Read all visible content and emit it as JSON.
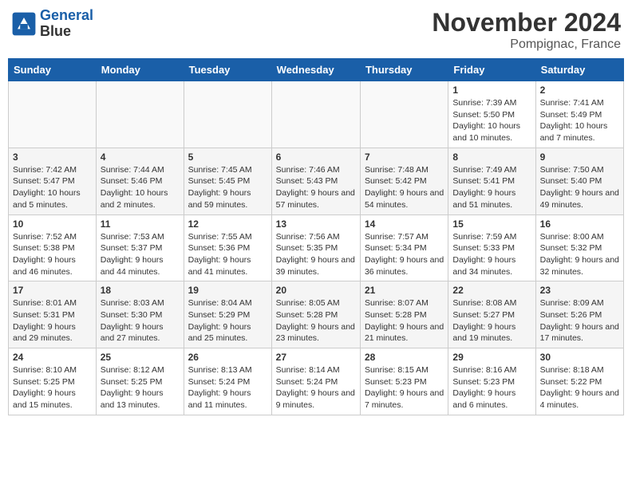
{
  "header": {
    "logo_line1": "General",
    "logo_line2": "Blue",
    "month_title": "November 2024",
    "location": "Pompignac, France"
  },
  "weekdays": [
    "Sunday",
    "Monday",
    "Tuesday",
    "Wednesday",
    "Thursday",
    "Friday",
    "Saturday"
  ],
  "weeks": [
    [
      {
        "day": "",
        "info": ""
      },
      {
        "day": "",
        "info": ""
      },
      {
        "day": "",
        "info": ""
      },
      {
        "day": "",
        "info": ""
      },
      {
        "day": "",
        "info": ""
      },
      {
        "day": "1",
        "info": "Sunrise: 7:39 AM\nSunset: 5:50 PM\nDaylight: 10 hours and 10 minutes."
      },
      {
        "day": "2",
        "info": "Sunrise: 7:41 AM\nSunset: 5:49 PM\nDaylight: 10 hours and 7 minutes."
      }
    ],
    [
      {
        "day": "3",
        "info": "Sunrise: 7:42 AM\nSunset: 5:47 PM\nDaylight: 10 hours and 5 minutes."
      },
      {
        "day": "4",
        "info": "Sunrise: 7:44 AM\nSunset: 5:46 PM\nDaylight: 10 hours and 2 minutes."
      },
      {
        "day": "5",
        "info": "Sunrise: 7:45 AM\nSunset: 5:45 PM\nDaylight: 9 hours and 59 minutes."
      },
      {
        "day": "6",
        "info": "Sunrise: 7:46 AM\nSunset: 5:43 PM\nDaylight: 9 hours and 57 minutes."
      },
      {
        "day": "7",
        "info": "Sunrise: 7:48 AM\nSunset: 5:42 PM\nDaylight: 9 hours and 54 minutes."
      },
      {
        "day": "8",
        "info": "Sunrise: 7:49 AM\nSunset: 5:41 PM\nDaylight: 9 hours and 51 minutes."
      },
      {
        "day": "9",
        "info": "Sunrise: 7:50 AM\nSunset: 5:40 PM\nDaylight: 9 hours and 49 minutes."
      }
    ],
    [
      {
        "day": "10",
        "info": "Sunrise: 7:52 AM\nSunset: 5:38 PM\nDaylight: 9 hours and 46 minutes."
      },
      {
        "day": "11",
        "info": "Sunrise: 7:53 AM\nSunset: 5:37 PM\nDaylight: 9 hours and 44 minutes."
      },
      {
        "day": "12",
        "info": "Sunrise: 7:55 AM\nSunset: 5:36 PM\nDaylight: 9 hours and 41 minutes."
      },
      {
        "day": "13",
        "info": "Sunrise: 7:56 AM\nSunset: 5:35 PM\nDaylight: 9 hours and 39 minutes."
      },
      {
        "day": "14",
        "info": "Sunrise: 7:57 AM\nSunset: 5:34 PM\nDaylight: 9 hours and 36 minutes."
      },
      {
        "day": "15",
        "info": "Sunrise: 7:59 AM\nSunset: 5:33 PM\nDaylight: 9 hours and 34 minutes."
      },
      {
        "day": "16",
        "info": "Sunrise: 8:00 AM\nSunset: 5:32 PM\nDaylight: 9 hours and 32 minutes."
      }
    ],
    [
      {
        "day": "17",
        "info": "Sunrise: 8:01 AM\nSunset: 5:31 PM\nDaylight: 9 hours and 29 minutes."
      },
      {
        "day": "18",
        "info": "Sunrise: 8:03 AM\nSunset: 5:30 PM\nDaylight: 9 hours and 27 minutes."
      },
      {
        "day": "19",
        "info": "Sunrise: 8:04 AM\nSunset: 5:29 PM\nDaylight: 9 hours and 25 minutes."
      },
      {
        "day": "20",
        "info": "Sunrise: 8:05 AM\nSunset: 5:28 PM\nDaylight: 9 hours and 23 minutes."
      },
      {
        "day": "21",
        "info": "Sunrise: 8:07 AM\nSunset: 5:28 PM\nDaylight: 9 hours and 21 minutes."
      },
      {
        "day": "22",
        "info": "Sunrise: 8:08 AM\nSunset: 5:27 PM\nDaylight: 9 hours and 19 minutes."
      },
      {
        "day": "23",
        "info": "Sunrise: 8:09 AM\nSunset: 5:26 PM\nDaylight: 9 hours and 17 minutes."
      }
    ],
    [
      {
        "day": "24",
        "info": "Sunrise: 8:10 AM\nSunset: 5:25 PM\nDaylight: 9 hours and 15 minutes."
      },
      {
        "day": "25",
        "info": "Sunrise: 8:12 AM\nSunset: 5:25 PM\nDaylight: 9 hours and 13 minutes."
      },
      {
        "day": "26",
        "info": "Sunrise: 8:13 AM\nSunset: 5:24 PM\nDaylight: 9 hours and 11 minutes."
      },
      {
        "day": "27",
        "info": "Sunrise: 8:14 AM\nSunset: 5:24 PM\nDaylight: 9 hours and 9 minutes."
      },
      {
        "day": "28",
        "info": "Sunrise: 8:15 AM\nSunset: 5:23 PM\nDaylight: 9 hours and 7 minutes."
      },
      {
        "day": "29",
        "info": "Sunrise: 8:16 AM\nSunset: 5:23 PM\nDaylight: 9 hours and 6 minutes."
      },
      {
        "day": "30",
        "info": "Sunrise: 8:18 AM\nSunset: 5:22 PM\nDaylight: 9 hours and 4 minutes."
      }
    ]
  ]
}
